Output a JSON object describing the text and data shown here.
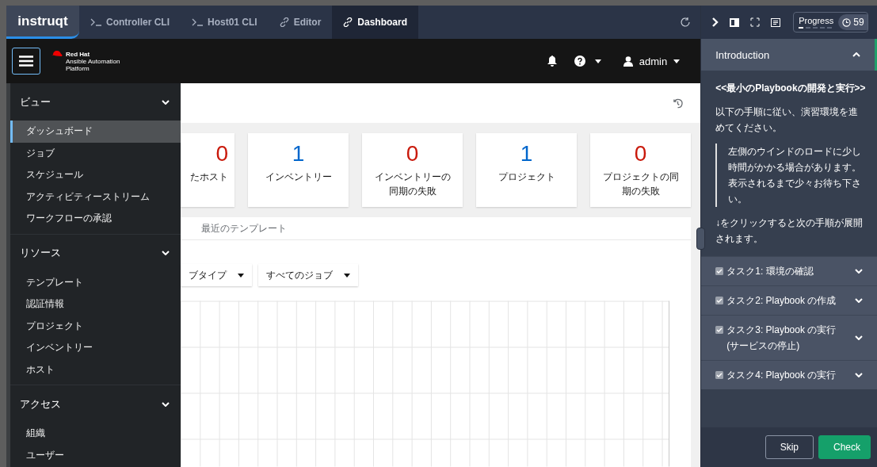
{
  "logo": "instruqt",
  "tabs": [
    {
      "label": "Controller CLI",
      "kind": "terminal",
      "selected": false
    },
    {
      "label": "Host01 CLI",
      "kind": "terminal",
      "selected": false
    },
    {
      "label": "Editor",
      "kind": "link",
      "selected": false
    },
    {
      "label": "Dashboard",
      "kind": "link",
      "selected": true
    }
  ],
  "app_header": {
    "company": "Red Hat",
    "product": "Ansible Automation Platform",
    "user": "admin"
  },
  "sidebar": {
    "sections": [
      {
        "title": "ビュー",
        "expanded": true,
        "items": [
          {
            "label": "ダッシュボード",
            "selected": true
          },
          {
            "label": "ジョブ",
            "selected": false
          },
          {
            "label": "スケジュール",
            "selected": false
          },
          {
            "label": "アクティビティーストリーム",
            "selected": false
          },
          {
            "label": "ワークフローの承認",
            "selected": false
          }
        ]
      },
      {
        "title": "リソース",
        "expanded": true,
        "items": [
          {
            "label": "テンプレート",
            "selected": false
          },
          {
            "label": "認証情報",
            "selected": false
          },
          {
            "label": "プロジェクト",
            "selected": false
          },
          {
            "label": "インベントリー",
            "selected": false
          },
          {
            "label": "ホスト",
            "selected": false
          }
        ]
      },
      {
        "title": "アクセス",
        "expanded": true,
        "items": [
          {
            "label": "組織",
            "selected": false
          },
          {
            "label": "ユーザー",
            "selected": false
          }
        ]
      }
    ]
  },
  "cards": [
    {
      "value": "0",
      "label": "たホスト",
      "color": "#c9190b"
    },
    {
      "value": "1",
      "label": "インベントリー",
      "color": "#0066cc"
    },
    {
      "value": "0",
      "label": "インベントリーの同期の失敗",
      "color": "#c9190b"
    },
    {
      "value": "1",
      "label": "プロジェクト",
      "color": "#0066cc"
    },
    {
      "value": "0",
      "label": "プロジェクトの同期の失敗",
      "color": "#c9190b"
    }
  ],
  "content_tab": "最近のテンプレート",
  "filters": [
    "ブタイプ",
    "すべてのジョブ"
  ],
  "panel": {
    "progress_label": "Progress",
    "timer": "59",
    "section": {
      "title": "Introduction",
      "expanded": true
    },
    "heading": "<<最小のPlaybookの開発と実行>>",
    "intro": "以下の手順に従い、演習環境を進めてください。",
    "note": "左側のウインドのロードに少し時間がかかる場合があります。表示されるまで少々お待ち下さい。",
    "hint": "↓をクリックすると次の手順が展開されます。",
    "tasks": [
      {
        "label": "タスク1: 環境の確認",
        "checked": true
      },
      {
        "label": "タスク2: Playbook の作成",
        "checked": true
      },
      {
        "label": "タスク3: Playbook の実行 (サービスの停止)",
        "checked": true
      },
      {
        "label": "タスク4: Playbook の実行",
        "checked": true
      }
    ],
    "buttons": [
      {
        "label": "Skip",
        "kind": "secondary"
      },
      {
        "label": "Check",
        "kind": "primary"
      }
    ]
  }
}
